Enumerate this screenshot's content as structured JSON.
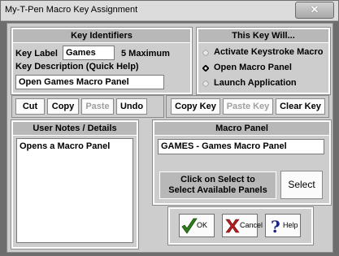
{
  "window": {
    "title": "My-T-Pen Macro Key Assignment",
    "close_glyph": "✕"
  },
  "identifiers": {
    "header": "Key Identifiers",
    "key_label_caption": "Key Label",
    "key_label_value": "Games",
    "max_hint": "5 Maximum",
    "description_caption": "Key Description (Quick Help)",
    "description_value": "Open Games Macro Panel"
  },
  "this_key_will": {
    "header": "This Key Will...",
    "options": [
      {
        "label": "Activate Keystroke Macro",
        "selected": false
      },
      {
        "label": "Open Macro Panel",
        "selected": true
      },
      {
        "label": "Launch Application",
        "selected": false
      }
    ]
  },
  "toolbar": {
    "cut": "Cut",
    "copy": "Copy",
    "paste": "Paste",
    "undo": "Undo",
    "copy_key": "Copy Key",
    "paste_key": "Paste Key",
    "clear_key": "Clear Key"
  },
  "notes": {
    "header": "User Notes / Details",
    "value": "Opens a Macro Panel"
  },
  "macro_panel": {
    "header": "Macro Panel",
    "value": "GAMES - Games Macro Panel",
    "info_line1": "Click on Select to",
    "info_line2": "Select Available Panels",
    "select_label": "Select"
  },
  "dialog_buttons": {
    "ok": "OK",
    "cancel": "Cancel",
    "help": "Help"
  },
  "colors": {
    "ok_check": "#2e7d1c",
    "cancel_x": "#b71c1c",
    "help_q": "#1a237e"
  }
}
